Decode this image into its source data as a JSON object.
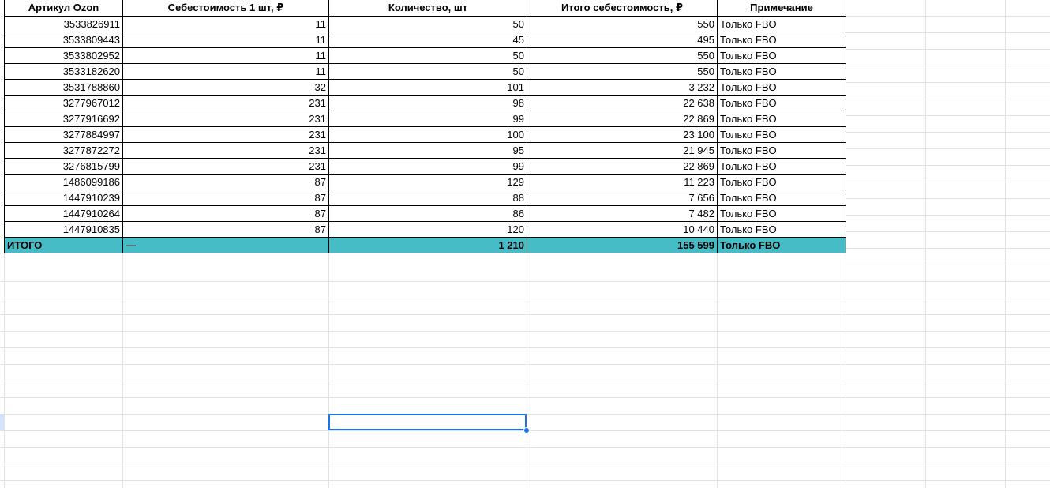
{
  "table": {
    "headers": [
      "Артикул Ozon",
      "Себестоимость 1 шт, ₽",
      "Количество, шт",
      "Итого себестоимость, ₽",
      "Примечание"
    ],
    "rows": [
      [
        "3533826911",
        "11",
        "50",
        "550",
        "Только FBO"
      ],
      [
        "3533809443",
        "11",
        "45",
        "495",
        "Только FBO"
      ],
      [
        "3533802952",
        "11",
        "50",
        "550",
        "Только FBO"
      ],
      [
        "3533182620",
        "11",
        "50",
        "550",
        "Только FBO"
      ],
      [
        "3531788860",
        "32",
        "101",
        "3 232",
        "Только FBO"
      ],
      [
        "3277967012",
        "231",
        "98",
        "22 638",
        "Только FBO"
      ],
      [
        "3277916692",
        "231",
        "99",
        "22 869",
        "Только FBO"
      ],
      [
        "3277884997",
        "231",
        "100",
        "23 100",
        "Только FBO"
      ],
      [
        "3277872272",
        "231",
        "95",
        "21 945",
        "Только FBO"
      ],
      [
        "3276815799",
        "231",
        "99",
        "22 869",
        "Только FBO"
      ],
      [
        "1486099186",
        "87",
        "129",
        "11 223",
        "Только FBO"
      ],
      [
        "1447910239",
        "87",
        "88",
        "7 656",
        "Только FBO"
      ],
      [
        "1447910264",
        "87",
        "86",
        "7 482",
        "Только FBO"
      ],
      [
        "1447910835",
        "87",
        "120",
        "10 440",
        "Только FBO"
      ]
    ],
    "total": {
      "label": "ИТОГО",
      "cost_per_unit": "—",
      "quantity": "1 210",
      "total_cost": "155 599",
      "note": "Только FBO"
    }
  },
  "colors": {
    "total_row_fill": "#45bcc6",
    "selection_border": "#1a73e8"
  }
}
